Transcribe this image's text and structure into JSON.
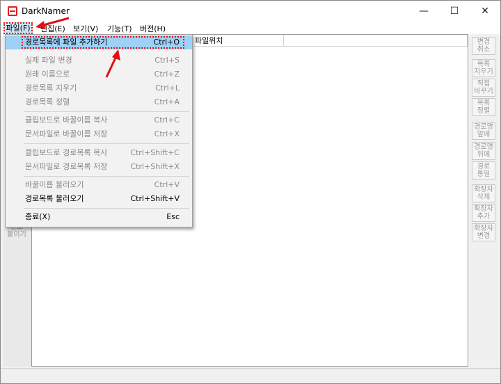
{
  "window": {
    "title": "DarkNamer",
    "minimize": "—",
    "maximize": "☐",
    "close": "✕"
  },
  "menubar": {
    "file": "파일(F)",
    "edit": "편집(E)",
    "view": "보기(V)",
    "function": "기능(T)",
    "version": "버전(H)"
  },
  "list": {
    "col_file_location": "파일위치"
  },
  "left_toolbar": {
    "button": "번호\n붙이기"
  },
  "right_toolbar": [
    "변경\n취소",
    "목록\n지우기",
    "직접\n바꾸기",
    "목록\n정렬",
    "경로명\n앞에",
    "경로명\n뒤에",
    "경로\n통일",
    "확장자\n삭제",
    "확장자\n추가",
    "확장자\n변경"
  ],
  "file_menu": {
    "items": [
      {
        "label": "경로목록에 파일 추가하기",
        "shortcut": "Ctrl+O"
      },
      {
        "label": "실제 파일 변경",
        "shortcut": "Ctrl+S"
      },
      {
        "label": "원래 이름으로",
        "shortcut": "Ctrl+Z"
      },
      {
        "label": "경로목록 지우기",
        "shortcut": "Ctrl+L"
      },
      {
        "label": "경로목록 정렬",
        "shortcut": "Ctrl+A"
      },
      {
        "label": "클립보드로 바꿀이름 복사",
        "shortcut": "Ctrl+C"
      },
      {
        "label": "문서파일로 바꿀이름 저장",
        "shortcut": "Ctrl+X"
      },
      {
        "label": "클립보드로 경로목록 복사",
        "shortcut": "Ctrl+Shift+C"
      },
      {
        "label": "문서파일로 경로목록 저장",
        "shortcut": "Ctrl+Shift+X"
      },
      {
        "label": "바꿀이름 불러오기",
        "shortcut": "Ctrl+V"
      },
      {
        "label": "경로목록 불러오기",
        "shortcut": "Ctrl+Shift+V"
      },
      {
        "label": "종료(X)",
        "shortcut": "Esc"
      }
    ]
  },
  "colors": {
    "highlight": "#9fd0f5",
    "annotation_red": "#e01010"
  }
}
